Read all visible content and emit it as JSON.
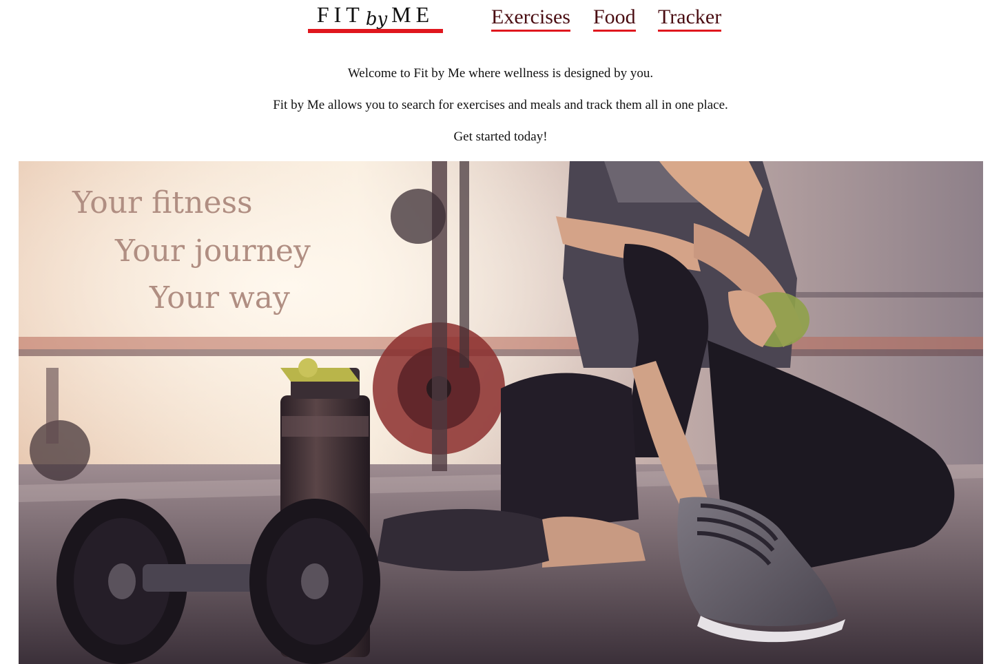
{
  "header": {
    "logo": {
      "word_1": "FIT",
      "word_2": "by",
      "word_3": "ME",
      "underline_color": "#e0171e"
    },
    "nav": [
      {
        "label": "Exercises"
      },
      {
        "label": "Food"
      },
      {
        "label": "Tracker"
      }
    ],
    "nav_text_color": "#4a0d12",
    "nav_underline_color": "#e0171e"
  },
  "intro": {
    "line_1": "Welcome to Fit by Me where wellness is designed by you.",
    "line_2": "Fit by Me allows you to search for exercises and meals and track them all in one place.",
    "line_3": "Get started today!"
  },
  "hero": {
    "tagline": [
      "Your fitness",
      "Your journey",
      "Your way"
    ],
    "tagline_color": "#b08e82"
  }
}
